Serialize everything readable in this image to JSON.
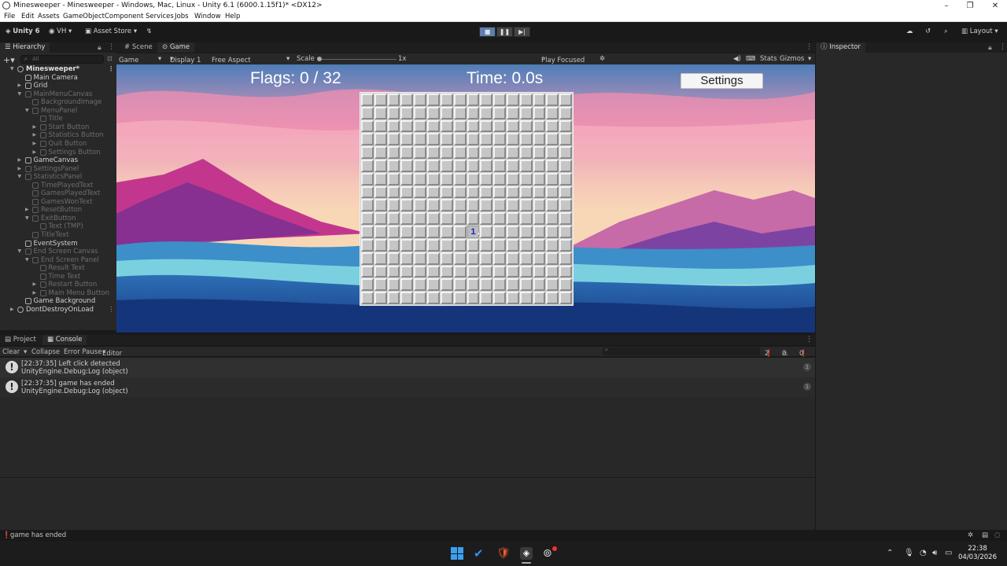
{
  "window": {
    "title": "Minesweeper - Minesweeper - Windows, Mac, Linux - Unity 6.1 (6000.1.15f1)* <DX12>"
  },
  "menu": [
    "File",
    "Edit",
    "Assets",
    "GameObject",
    "Component",
    "Services",
    "Jobs",
    "Window",
    "Help"
  ],
  "toolbar": {
    "unity_label": "Unity 6",
    "account_label": "VH",
    "asset_store_label": "Asset Store",
    "layout_label": "Layout"
  },
  "hierarchy": {
    "tab_label": "Hierarchy",
    "search_placeholder": "All",
    "items": [
      {
        "label": "Minesweeper*",
        "depth": 0,
        "style": "bold",
        "arrow": "open",
        "icon": "scene-icon"
      },
      {
        "label": "Main Camera",
        "depth": 1,
        "style": "normal",
        "arrow": "",
        "icon": "cube-icon"
      },
      {
        "label": "Grid",
        "depth": 1,
        "style": "normal",
        "arrow": "closed",
        "icon": "cube-icon"
      },
      {
        "label": "MainMenuCanvas",
        "depth": 1,
        "style": "dim",
        "arrow": "open",
        "icon": "cube-icon"
      },
      {
        "label": "BackgroundImage",
        "depth": 2,
        "style": "dim",
        "arrow": "",
        "icon": "cube-icon"
      },
      {
        "label": "MenuPanel",
        "depth": 2,
        "style": "dim",
        "arrow": "open",
        "icon": "cube-icon"
      },
      {
        "label": "Title",
        "depth": 3,
        "style": "dim",
        "arrow": "",
        "icon": "cube-icon"
      },
      {
        "label": "Start Button",
        "depth": 3,
        "style": "dim",
        "arrow": "closed",
        "icon": "cube-icon"
      },
      {
        "label": "Statistics Button",
        "depth": 3,
        "style": "dim",
        "arrow": "closed",
        "icon": "cube-icon"
      },
      {
        "label": "Quit Button",
        "depth": 3,
        "style": "dim",
        "arrow": "closed",
        "icon": "cube-icon"
      },
      {
        "label": "Settings Button",
        "depth": 3,
        "style": "dim",
        "arrow": "closed",
        "icon": "cube-icon"
      },
      {
        "label": "GameCanvas",
        "depth": 1,
        "style": "normal",
        "arrow": "closed",
        "icon": "cube-icon"
      },
      {
        "label": "SettingsPanel",
        "depth": 1,
        "style": "dim",
        "arrow": "closed",
        "icon": "cube-icon"
      },
      {
        "label": "StatisticsPanel",
        "depth": 1,
        "style": "dim",
        "arrow": "open",
        "icon": "cube-icon"
      },
      {
        "label": "TimePlayedText",
        "depth": 2,
        "style": "dim",
        "arrow": "",
        "icon": "cube-icon"
      },
      {
        "label": "GamesPlayedText",
        "depth": 2,
        "style": "dim",
        "arrow": "",
        "icon": "cube-icon"
      },
      {
        "label": "GamesWonText",
        "depth": 2,
        "style": "dim",
        "arrow": "",
        "icon": "cube-icon"
      },
      {
        "label": "ResetButton",
        "depth": 2,
        "style": "dim",
        "arrow": "closed",
        "icon": "cube-icon"
      },
      {
        "label": "ExitButton",
        "depth": 2,
        "style": "dim",
        "arrow": "open",
        "icon": "cube-icon"
      },
      {
        "label": "Text (TMP)",
        "depth": 3,
        "style": "dim",
        "arrow": "",
        "icon": "cube-icon"
      },
      {
        "label": "TitleText",
        "depth": 2,
        "style": "dim",
        "arrow": "",
        "icon": "cube-icon"
      },
      {
        "label": "EventSystem",
        "depth": 1,
        "style": "normal",
        "arrow": "",
        "icon": "cube-icon"
      },
      {
        "label": "End Screen Canvas",
        "depth": 1,
        "style": "dim",
        "arrow": "open",
        "icon": "cube-icon"
      },
      {
        "label": "End Screen Panel",
        "depth": 2,
        "style": "dim",
        "arrow": "open",
        "icon": "cube-icon"
      },
      {
        "label": "Result Text",
        "depth": 3,
        "style": "dim",
        "arrow": "",
        "icon": "cube-icon"
      },
      {
        "label": "Time Text",
        "depth": 3,
        "style": "dim",
        "arrow": "",
        "icon": "cube-icon"
      },
      {
        "label": "Restart Button",
        "depth": 3,
        "style": "dim",
        "arrow": "closed",
        "icon": "cube-icon"
      },
      {
        "label": "Main Menu Button",
        "depth": 3,
        "style": "dim",
        "arrow": "closed",
        "icon": "cube-icon"
      },
      {
        "label": "Game Background",
        "depth": 1,
        "style": "normal",
        "arrow": "",
        "icon": "cube-icon"
      },
      {
        "label": "DontDestroyOnLoad",
        "depth": 0,
        "style": "normal",
        "arrow": "closed",
        "icon": "scene-icon"
      }
    ]
  },
  "scene_tabs": {
    "scene_label": "Scene",
    "game_label": "Game"
  },
  "game_toolbar": {
    "view_label": "Game",
    "display_label": "Display 1",
    "aspect_label": "Free Aspect",
    "scale_label": "Scale",
    "scale_value": "1x",
    "play_mode_label": "Play Focused",
    "stats_label": "Stats",
    "gizmos_label": "Gizmos"
  },
  "game": {
    "flags_text": "Flags: 0 / 32",
    "time_text": "Time: 0.0s",
    "settings_label": "Settings",
    "board": {
      "rows": 16,
      "cols": 16,
      "revealed": [
        {
          "row": 10,
          "col": 8,
          "value": "1"
        }
      ]
    }
  },
  "inspector": {
    "tab_label": "Inspector"
  },
  "bottom_tabs": {
    "project_label": "Project",
    "console_label": "Console"
  },
  "console": {
    "clear_label": "Clear",
    "collapse_label": "Collapse",
    "error_pause_label": "Error Pause",
    "editor_label": "Editor",
    "log_count": "2",
    "warn_count": "0",
    "error_count": "0",
    "entries": [
      {
        "line1": "[22:37:35] Left click detected",
        "line2": "UnityEngine.Debug:Log (object)",
        "count": "1"
      },
      {
        "line1": "[22:37:35] game has ended",
        "line2": "UnityEngine.Debug:Log (object)",
        "count": "1"
      }
    ]
  },
  "status": {
    "message": "game has ended"
  },
  "taskbar": {
    "time": "22:38",
    "date": "04/03/2026"
  }
}
